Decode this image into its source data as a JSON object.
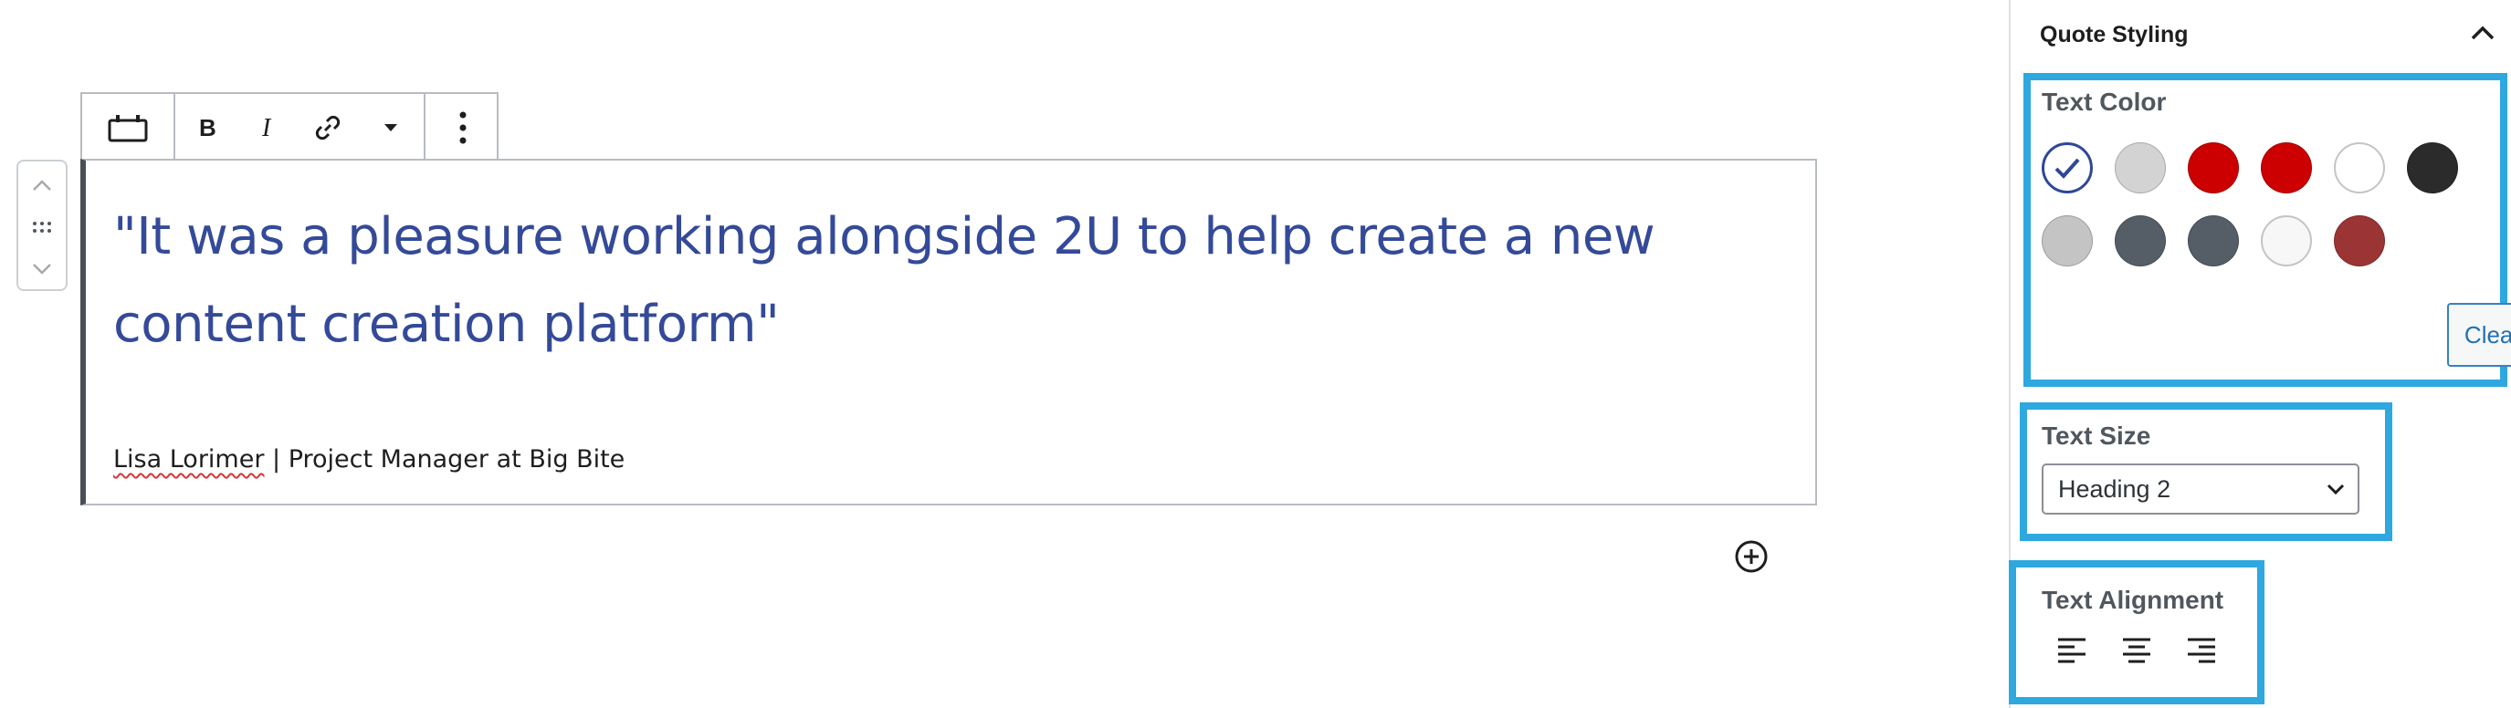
{
  "block": {
    "quote": "\"It was a pleasure working alongside 2U to help create a new content creation platform\"",
    "citation_name": "Lisa Lorimer",
    "citation_rest": " | Project Manager at Big Bite"
  },
  "toolbar": {
    "items": [
      "block-type-icon",
      "bold-icon",
      "italic-icon",
      "link-icon",
      "more-formats-caret-icon",
      "more-options-icon"
    ]
  },
  "sidebar": {
    "panel_title": "Quote Styling",
    "text_color": {
      "label": "Text Color",
      "swatches": [
        "#ffffff",
        "#d3d3d3",
        "#cc0000",
        "#cc0000",
        "#ffffff",
        "#2b2b2b",
        "#c4c4c4",
        "#555d66",
        "#555d66",
        "#f7f7f7",
        "#9b3535"
      ],
      "selected_index": 0,
      "selected_color": "#2e4799",
      "clear_label": "Clear"
    },
    "text_size": {
      "label": "Text Size",
      "value": "Heading 2"
    },
    "text_alignment": {
      "label": "Text Alignment",
      "options": [
        "align-left-icon",
        "align-center-icon",
        "align-right-icon"
      ]
    }
  },
  "colors": {
    "accent": "#344a99",
    "highlight": "#2ea8df",
    "link": "#2271b1"
  }
}
